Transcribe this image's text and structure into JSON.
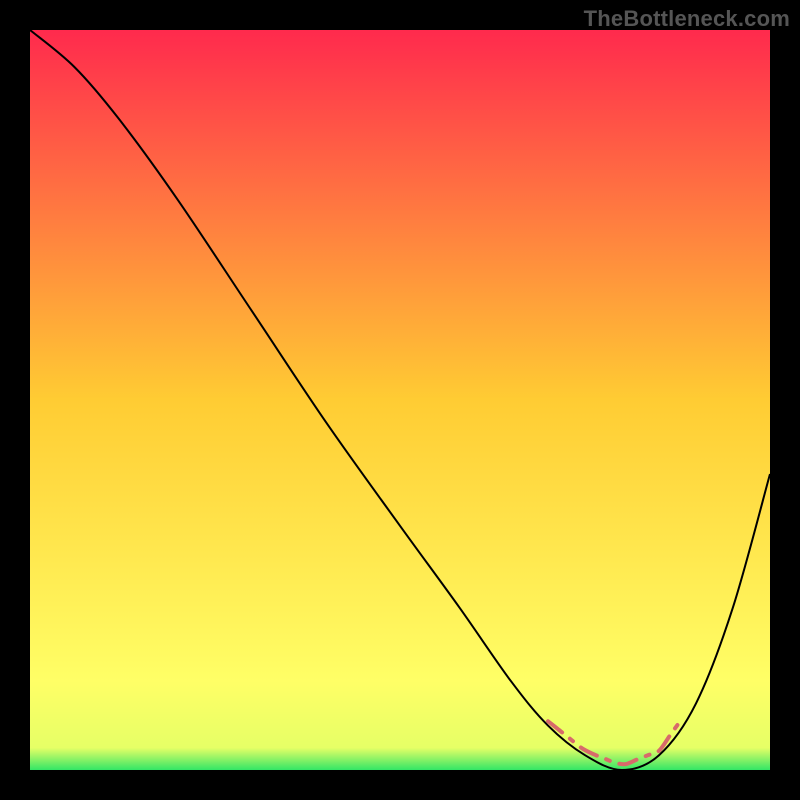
{
  "watermark": "TheBottleneck.com",
  "colors": {
    "gradient_top": "#ff2a4d",
    "gradient_mid": "#ffcc33",
    "gradient_low": "#ffff66",
    "gradient_near_bottom": "#e6ff66",
    "gradient_bottom": "#33e666",
    "curve_stroke": "#000000",
    "dash_stroke": "#d86a6a",
    "frame_background": "#000000"
  },
  "chart_data": {
    "type": "line",
    "title": "",
    "xlabel": "",
    "ylabel": "",
    "xlim": [
      0,
      100
    ],
    "ylim": [
      0,
      100
    ],
    "grid": false,
    "series": [
      {
        "name": "bottleneck_curve",
        "x": [
          0,
          6,
          12,
          20,
          30,
          40,
          50,
          58,
          65,
          70,
          75,
          80,
          85,
          90,
          95,
          100
        ],
        "y": [
          100,
          95,
          88,
          77,
          62,
          47,
          33,
          22,
          12,
          6,
          2,
          0,
          2,
          9,
          22,
          40
        ]
      }
    ],
    "optimal_range": {
      "x_start": 70,
      "x_end": 88
    },
    "annotations": []
  }
}
